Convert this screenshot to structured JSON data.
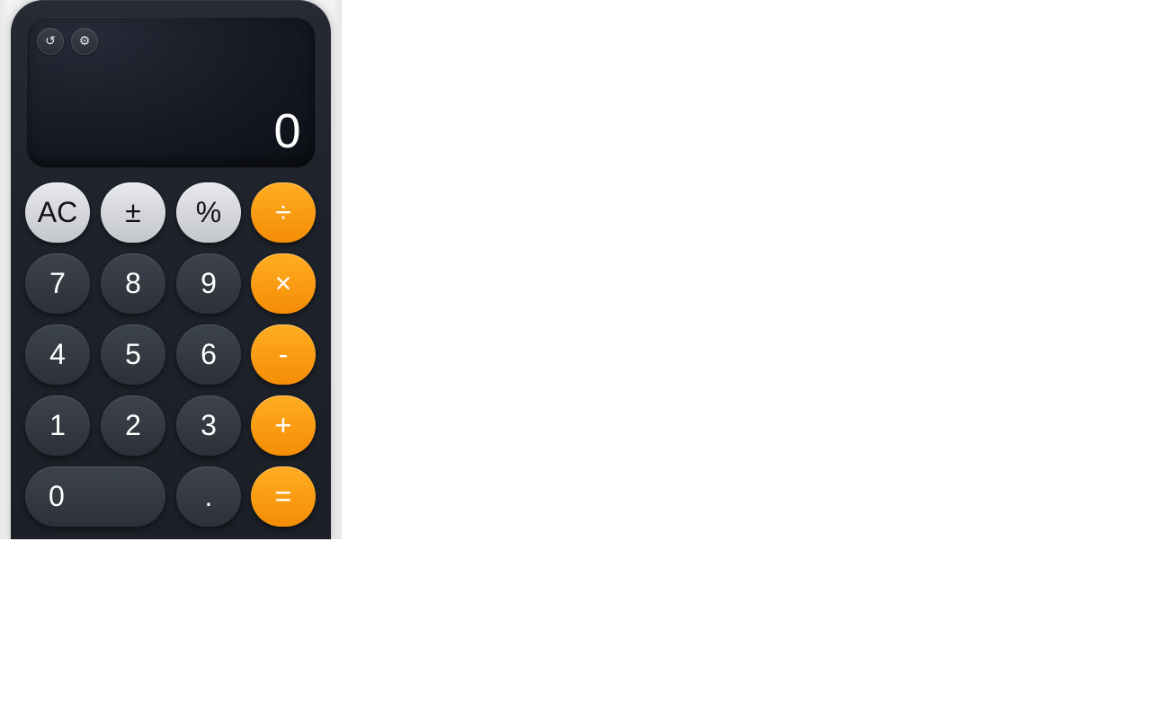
{
  "display": {
    "value": "0",
    "history_icon": "↺",
    "settings_icon": "⚙"
  },
  "keys": {
    "clear": "AC",
    "sign": "±",
    "percent": "%",
    "divide": "÷",
    "seven": "7",
    "eight": "8",
    "nine": "9",
    "multiply": "×",
    "four": "4",
    "five": "5",
    "six": "6",
    "subtract": "-",
    "one": "1",
    "two": "2",
    "three": "3",
    "add": "+",
    "zero": "0",
    "decimal": ".",
    "equals": "="
  },
  "colors": {
    "operator": "#ff9f0a",
    "function": "#d4d4d8",
    "number": "#333840",
    "body": "#1e222a"
  }
}
